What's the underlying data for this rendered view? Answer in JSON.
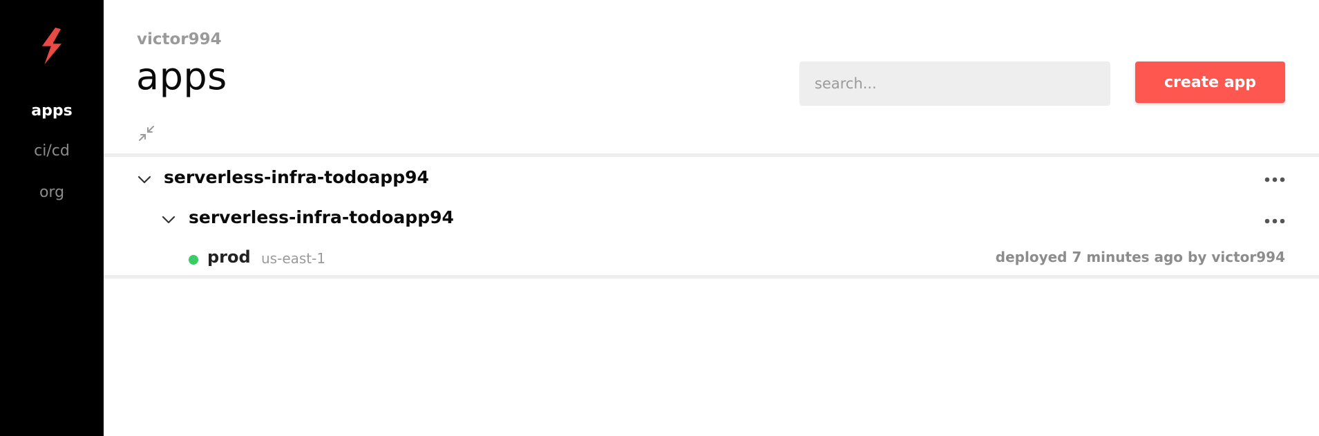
{
  "sidebar": {
    "logo_icon": "bolt-logo-icon",
    "items": [
      {
        "label": "apps",
        "active": true
      },
      {
        "label": "ci/cd",
        "active": false
      },
      {
        "label": "org",
        "active": false
      }
    ]
  },
  "header": {
    "org_name": "victor994",
    "title": "apps",
    "search_placeholder": "search...",
    "create_label": "create app"
  },
  "colors": {
    "accent": "#fd5750",
    "sidebar_bg": "#000000",
    "status_ok": "#3ccc66"
  },
  "apps": [
    {
      "name": "serverless-infra-todoapp94",
      "services": [
        {
          "name": "serverless-infra-todoapp94",
          "stages": [
            {
              "name": "prod",
              "region": "us-east-1",
              "deployed_text": "deployed 7 minutes ago by victor994"
            }
          ]
        }
      ]
    }
  ]
}
